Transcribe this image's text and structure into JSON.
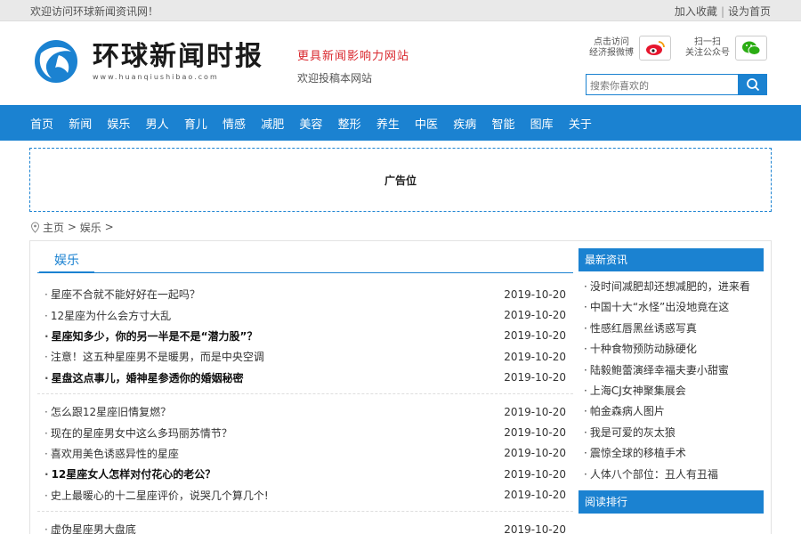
{
  "topbar": {
    "welcome": "欢迎访问环球新闻资讯网！",
    "bookmark": "加入收藏",
    "sep": "|",
    "homepage": "设为首页"
  },
  "header": {
    "logo_title": "环球新闻时报",
    "logo_url": "www.huanqiushibao.com",
    "slogan_main": "更具新闻影响力网站",
    "slogan_sub": "欢迎投稿本网站",
    "weibo_label_1": "点击访问",
    "weibo_label_2": "经济报微博",
    "wechat_label_1": "扫一扫",
    "wechat_label_2": "关注公众号",
    "search_placeholder": "搜索你喜欢的"
  },
  "nav": [
    "首页",
    "新闻",
    "娱乐",
    "男人",
    "育儿",
    "情感",
    "减肥",
    "美容",
    "整形",
    "养生",
    "中医",
    "疾病",
    "智能",
    "图库",
    "关于"
  ],
  "ad": {
    "label": "广告位"
  },
  "breadcrumb": {
    "home": "主页",
    "sep1": ">",
    "current": "娱乐",
    "sep2": ">"
  },
  "section": {
    "title": "娱乐"
  },
  "groups": [
    [
      {
        "title": "星座不合就不能好好在一起吗？",
        "date": "2019-10-20",
        "bold": false
      },
      {
        "title": "12星座为什么会方寸大乱",
        "date": "2019-10-20",
        "bold": false
      },
      {
        "title": "星座知多少，你的另一半是不是“潜力股”？",
        "date": "2019-10-20",
        "bold": true
      },
      {
        "title": "注意！这五种星座男不是暖男，而是中央空调",
        "date": "2019-10-20",
        "bold": false
      },
      {
        "title": "星盘这点事儿，婚神星参透你的婚姻秘密",
        "date": "2019-10-20",
        "bold": true
      }
    ],
    [
      {
        "title": "怎么跟12星座旧情复燃？",
        "date": "2019-10-20",
        "bold": false
      },
      {
        "title": "现在的星座男女中这么多玛丽苏情节？",
        "date": "2019-10-20",
        "bold": false
      },
      {
        "title": "喜欢用美色诱惑异性的星座",
        "date": "2019-10-20",
        "bold": false
      },
      {
        "title": "12星座女人怎样对付花心的老公？",
        "date": "2019-10-20",
        "bold": true
      },
      {
        "title": "史上最暖心的十二星座评价，说哭几个算几个!",
        "date": "2019-10-20",
        "bold": false
      }
    ],
    [
      {
        "title": "虚伪星座男大盘底",
        "date": "2019-10-20",
        "bold": false
      }
    ]
  ],
  "sidebar": {
    "latest_title": "最新资讯",
    "latest": [
      "没时间减肥却还想减肥的，进来看",
      "中国十大“水怪”出没地竟在这",
      "性感红唇黑丝诱惑写真",
      "十种食物预防动脉硬化",
      "陆毅鲍蕾演绎幸福夫妻小甜蜜",
      "上海CJ女神聚集展会",
      "帕金森病人图片",
      "我是可爱的灰太狼",
      "震惊全球的移植手术",
      "人体八个部位：丑人有丑福"
    ],
    "ranking_title": "阅读排行"
  },
  "colors": {
    "brand": "#1b82d1",
    "slogan": "#d9272d",
    "weibo": "#e6162d",
    "wechat": "#2bad13"
  }
}
